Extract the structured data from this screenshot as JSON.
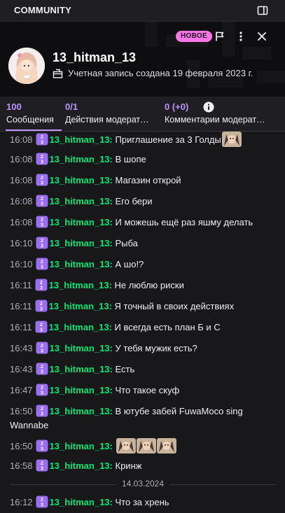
{
  "topbar": {
    "title": "COMMUNITY",
    "icon": "panel-icon"
  },
  "header": {
    "badge": "НОВОЕ",
    "username": "13_hitman_13",
    "created": "Учетная запись создана 19 февраля 2023 г."
  },
  "tabs": [
    {
      "count": "100",
      "label": "Сообщения"
    },
    {
      "count": "0/1",
      "label": "Действия модерат…"
    },
    {
      "count": "0 (+0)",
      "label": "Комментарии модерат…"
    }
  ],
  "messages": [
    {
      "time": "16:08",
      "user": "13_hitman_13",
      "text": "Приглашение за 3 Голды"
    },
    {
      "time": "16:08",
      "user": "13_hitman_13",
      "text": "В шопе"
    },
    {
      "time": "16:08",
      "user": "13_hitman_13",
      "text": "Магазин открой"
    },
    {
      "time": "16:08",
      "user": "13_hitman_13",
      "text": "Его бери"
    },
    {
      "time": "16:08",
      "user": "13_hitman_13",
      "text": "И можешь ещё раз яшму делать"
    },
    {
      "time": "16:10",
      "user": "13_hitman_13",
      "text": "Рыба"
    },
    {
      "time": "16:10",
      "user": "13_hitman_13",
      "text": "А шо!?"
    },
    {
      "time": "16:11",
      "user": "13_hitman_13",
      "text": "Не люблю риски"
    },
    {
      "time": "16:11",
      "user": "13_hitman_13",
      "text": "Я точный в своих действиях"
    },
    {
      "time": "16:11",
      "user": "13_hitman_13",
      "text": "И всегда есть план Б и С"
    },
    {
      "time": "16:43",
      "user": "13_hitman_13",
      "text": "У тебя мужик есть?"
    },
    {
      "time": "16:43",
      "user": "13_hitman_13",
      "text": "Есть"
    },
    {
      "time": "16:47",
      "user": "13_hitman_13",
      "text": "Что такое скуф"
    },
    {
      "time": "16:50",
      "user": "13_hitman_13",
      "text": "В ютубе забей FuwaMoco sing Wannabe"
    },
    {
      "time": "16:50",
      "user": "13_hitman_13",
      "text": ""
    },
    {
      "time": "16:58",
      "user": "13_hitman_13",
      "text": "Кринж"
    },
    {
      "time": "16:12",
      "user": "13_hitman_13",
      "text": "Что за хрень"
    }
  ],
  "date_separator": "14.03.2024",
  "colors": {
    "accent": "#bf94ff",
    "username": "#00e676",
    "badge": "#ff75e6"
  }
}
